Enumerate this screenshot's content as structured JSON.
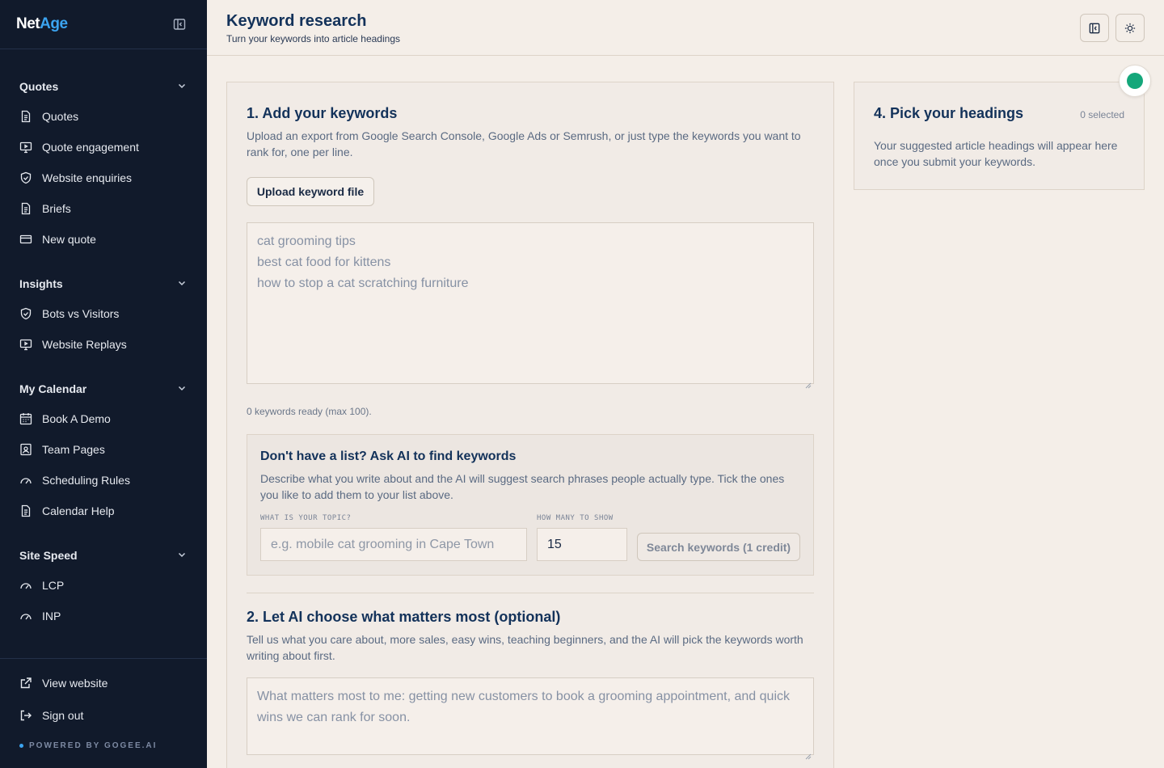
{
  "brand": {
    "part1": "Net",
    "part2": "Age"
  },
  "sidebar": {
    "sections": [
      {
        "title": "Quotes",
        "items": [
          {
            "label": "Quotes",
            "icon": "document-icon"
          },
          {
            "label": "Quote engagement",
            "icon": "monitor-icon"
          },
          {
            "label": "Website enquiries",
            "icon": "shield-icon"
          },
          {
            "label": "Briefs",
            "icon": "document-icon"
          },
          {
            "label": "New quote",
            "icon": "card-icon"
          }
        ]
      },
      {
        "title": "Insights",
        "items": [
          {
            "label": "Bots vs Visitors",
            "icon": "shield-icon"
          },
          {
            "label": "Website Replays",
            "icon": "monitor-icon"
          }
        ]
      },
      {
        "title": "My Calendar",
        "items": [
          {
            "label": "Book A Demo",
            "icon": "calendar-icon"
          },
          {
            "label": "Team Pages",
            "icon": "user-card-icon"
          },
          {
            "label": "Scheduling Rules",
            "icon": "gauge-icon"
          },
          {
            "label": "Calendar Help",
            "icon": "document-icon"
          }
        ]
      },
      {
        "title": "Site Speed",
        "items": [
          {
            "label": "LCP",
            "icon": "gauge-icon"
          },
          {
            "label": "INP",
            "icon": "gauge-icon"
          }
        ]
      }
    ],
    "bottom": {
      "view_website": "View website",
      "sign_out": "Sign out",
      "powered_by": "POWERED BY GOGEE.AI"
    }
  },
  "header": {
    "title": "Keyword research",
    "subtitle": "Turn your keywords into article headings"
  },
  "step1": {
    "title": "1. Add your keywords",
    "description": "Upload an export from Google Search Console, Google Ads or Semrush, or just type the keywords you want to rank for, one per line.",
    "upload_label": "Upload keyword file",
    "placeholder": "cat grooming tips\nbest cat food for kittens\nhow to stop a cat scratching furniture",
    "count_text": "0 keywords ready (max 100)."
  },
  "ai_finder": {
    "title": "Don't have a list? Ask AI to find keywords",
    "description": "Describe what you write about and the AI will suggest search phrases people actually type. Tick the ones you like to add them to your list above.",
    "topic_label": "WHAT IS YOUR TOPIC?",
    "topic_placeholder": "e.g. mobile cat grooming in Cape Town",
    "count_label": "HOW MANY TO SHOW",
    "count_value": "15",
    "search_label": "Search keywords (1 credit)"
  },
  "step2": {
    "title": "2. Let AI choose what matters most (optional)",
    "description": "Tell us what you care about, more sales, easy wins, teaching beginners, and the AI will pick the keywords worth writing about first.",
    "placeholder": "What matters most to me: getting new customers to book a grooming appointment, and quick wins we can rank for soon."
  },
  "step4": {
    "title": "4. Pick your headings",
    "selected": "0 selected",
    "empty_text": "Your suggested article headings will appear here once you submit your keywords."
  },
  "colors": {
    "accent": "#3ba4f0",
    "status": "#14a77a",
    "sidebar_bg": "#111a2b"
  }
}
